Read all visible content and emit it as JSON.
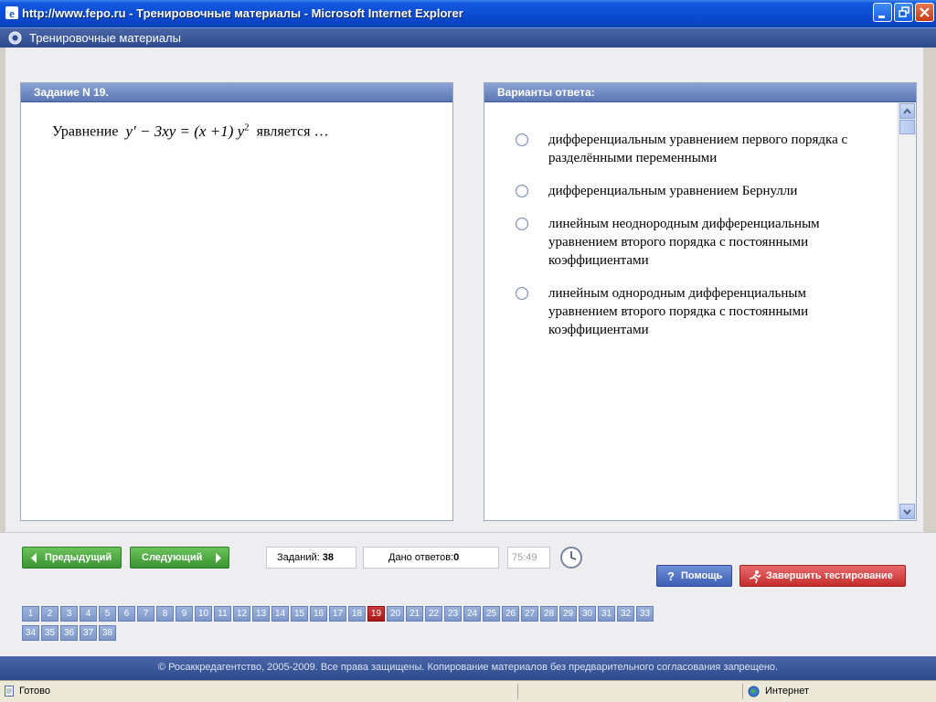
{
  "window": {
    "title": "http://www.fepo.ru - Тренировочные материалы - Microsoft Internet Explorer"
  },
  "app": {
    "title": "Тренировочные материалы"
  },
  "task": {
    "header": "Задание N 19.",
    "prefix": "Уравнение",
    "formula_lhs": "y′ − 3xy = (x +1) y",
    "formula_power": "2",
    "suffix": "является …"
  },
  "answers": {
    "header": "Варианты ответа:",
    "options": [
      "дифференциальным уравнением первого порядка с разделёнными переменными",
      "дифференциальным уравнением Бернулли",
      "линейным неоднородным дифференциальным уравнением второго порядка с постоянными коэффициентами",
      "линейным однородным дифференциальным уравнением второго порядка с постоянными коэффициентами"
    ]
  },
  "nav": {
    "prev_label": "Предыдущий",
    "next_label": "Следующий",
    "tasks_label": "Заданий:",
    "tasks_count": "38",
    "answered_label": "Дано ответов:",
    "answered_count": "0",
    "timer": "75:49",
    "help_label": "Помощь",
    "finish_label": "Завершить тестирование"
  },
  "questions": {
    "numbers": [
      "1",
      "2",
      "3",
      "4",
      "5",
      "6",
      "7",
      "8",
      "9",
      "10",
      "11",
      "12",
      "13",
      "14",
      "15",
      "16",
      "17",
      "18",
      "19",
      "20",
      "21",
      "22",
      "23",
      "24",
      "25",
      "26",
      "27",
      "28",
      "29",
      "30",
      "31",
      "32",
      "33",
      "34",
      "35",
      "36",
      "37",
      "38"
    ],
    "current": "19",
    "per_row": 33
  },
  "footer": {
    "copyright": "© Росаккредагентство, 2005-2009. Все права защищены. Копирование материалов без предварительного согласования запрещено."
  },
  "statusbar": {
    "status": "Готово",
    "zone": "Интернет"
  },
  "icons": {
    "browser": "ie-icon",
    "minimize": "minimize-icon",
    "maximize": "maximize-icon",
    "close": "close-icon",
    "clock": "clock-icon",
    "help": "help-icon",
    "finish": "runner-icon",
    "zone": "globe-icon"
  },
  "colors": {
    "titlebar": "#0a4bd4",
    "header": "#2c4b8c",
    "green_button": "#3a9332",
    "red_button": "#c42d2d",
    "active_number": "#a81818"
  }
}
